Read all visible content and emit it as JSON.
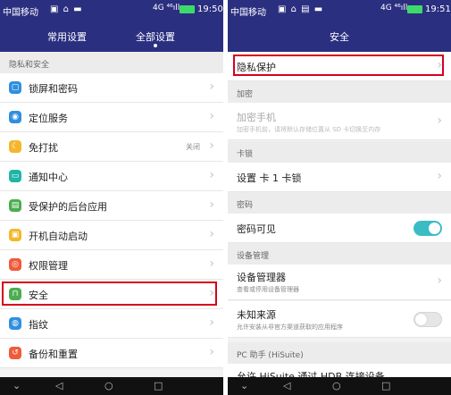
{
  "colors": {
    "primary": "#2b2f80",
    "highlight": "#d6001c",
    "toggle_on": "#3bbcc5"
  },
  "status_bar": {
    "carrier": "中国移动",
    "network": "4G ⁴⁶ıll",
    "time_left": "19:50",
    "time_right": "19:51"
  },
  "left_screen": {
    "tabs": [
      {
        "label": "常用设置"
      },
      {
        "label": "全部设置",
        "active": true
      }
    ],
    "section": "隐私和安全",
    "items": [
      {
        "label": "锁屏和密码",
        "icon": "lock-screen-icon",
        "color": "#2f8fde"
      },
      {
        "label": "定位服务",
        "icon": "location-pin-icon",
        "color": "#2f8fde"
      },
      {
        "label": "免打扰",
        "icon": "moon-icon",
        "color": "#f5b72a",
        "value": "关闭"
      },
      {
        "label": "通知中心",
        "icon": "notification-icon",
        "color": "#1fb5a6"
      },
      {
        "label": "受保护的后台应用",
        "icon": "protected-apps-icon",
        "color": "#4cae4f"
      },
      {
        "label": "开机自动启动",
        "icon": "autostart-icon",
        "color": "#f5b72a"
      },
      {
        "label": "权限管理",
        "icon": "permission-icon",
        "color": "#f15a3a"
      },
      {
        "label": "安全",
        "icon": "lock-icon",
        "color": "#4cae4f",
        "highlighted": true
      },
      {
        "label": "指纹",
        "icon": "fingerprint-icon",
        "color": "#2f8fde"
      },
      {
        "label": "备份和重置",
        "icon": "backup-icon",
        "color": "#f15a3a"
      }
    ]
  },
  "right_screen": {
    "title": "安全",
    "privacy": {
      "label": "隐私保护",
      "highlighted": true
    },
    "encryption": {
      "section": "加密",
      "label": "加密手机",
      "sub": "加密手机前，请将默认存储位置从 SD 卡切换至内存"
    },
    "sim_lock": {
      "section": "卡锁",
      "label": "设置 卡 1 卡锁"
    },
    "password": {
      "section": "密码",
      "label": "密码可见",
      "toggle": true
    },
    "device_admin": {
      "section": "设备管理",
      "admin_label": "设备管理器",
      "admin_sub": "查看或停用设备管理器",
      "unknown_label": "未知来源",
      "unknown_sub": "允许安装从非官方渠道获取的应用程序",
      "unknown_toggle": false
    },
    "pc_assistant": {
      "section": "PC 助手 (HiSuite)",
      "partial_label": "允许 HiSuite 通过 HDB 连接设备"
    }
  },
  "nav": {
    "back": "◁",
    "home": "○",
    "recent": "□",
    "down": "⌄"
  }
}
